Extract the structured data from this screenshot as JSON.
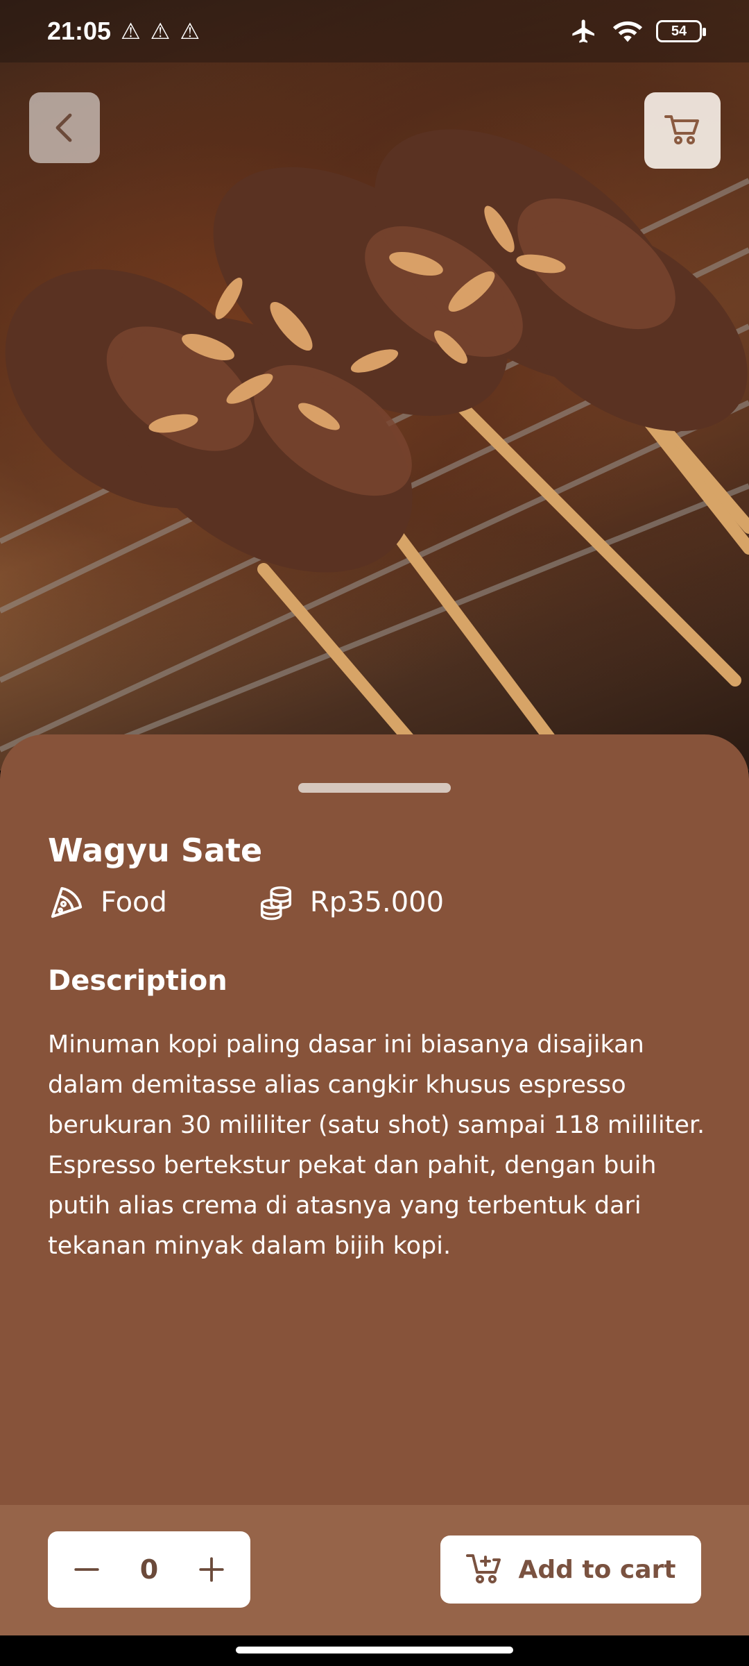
{
  "status_bar": {
    "time": "21:05",
    "warnings": [
      "⚠",
      "⚠",
      "⚠"
    ],
    "battery": "54",
    "icons": [
      "airplane-icon",
      "wifi-icon",
      "battery-icon"
    ]
  },
  "product": {
    "name": "Wagyu Sate",
    "category": "Food",
    "price": "Rp35.000",
    "description_title": "Description",
    "description": "Minuman kopi paling dasar ini biasanya disajikan dalam demitasse alias cangkir khusus espresso berukuran 30 mililiter (satu shot) sampai 118 mililiter. Espresso bertekstur pekat dan pahit, dengan buih putih alias crema di atasnya yang terbentuk dari tekanan minyak dalam bijih kopi."
  },
  "actions": {
    "quantity": "0",
    "add_to_cart_label": "Add to cart"
  },
  "colors": {
    "sheet": "#87533a",
    "action_bar": "#966449",
    "accent": "#7a5240"
  }
}
